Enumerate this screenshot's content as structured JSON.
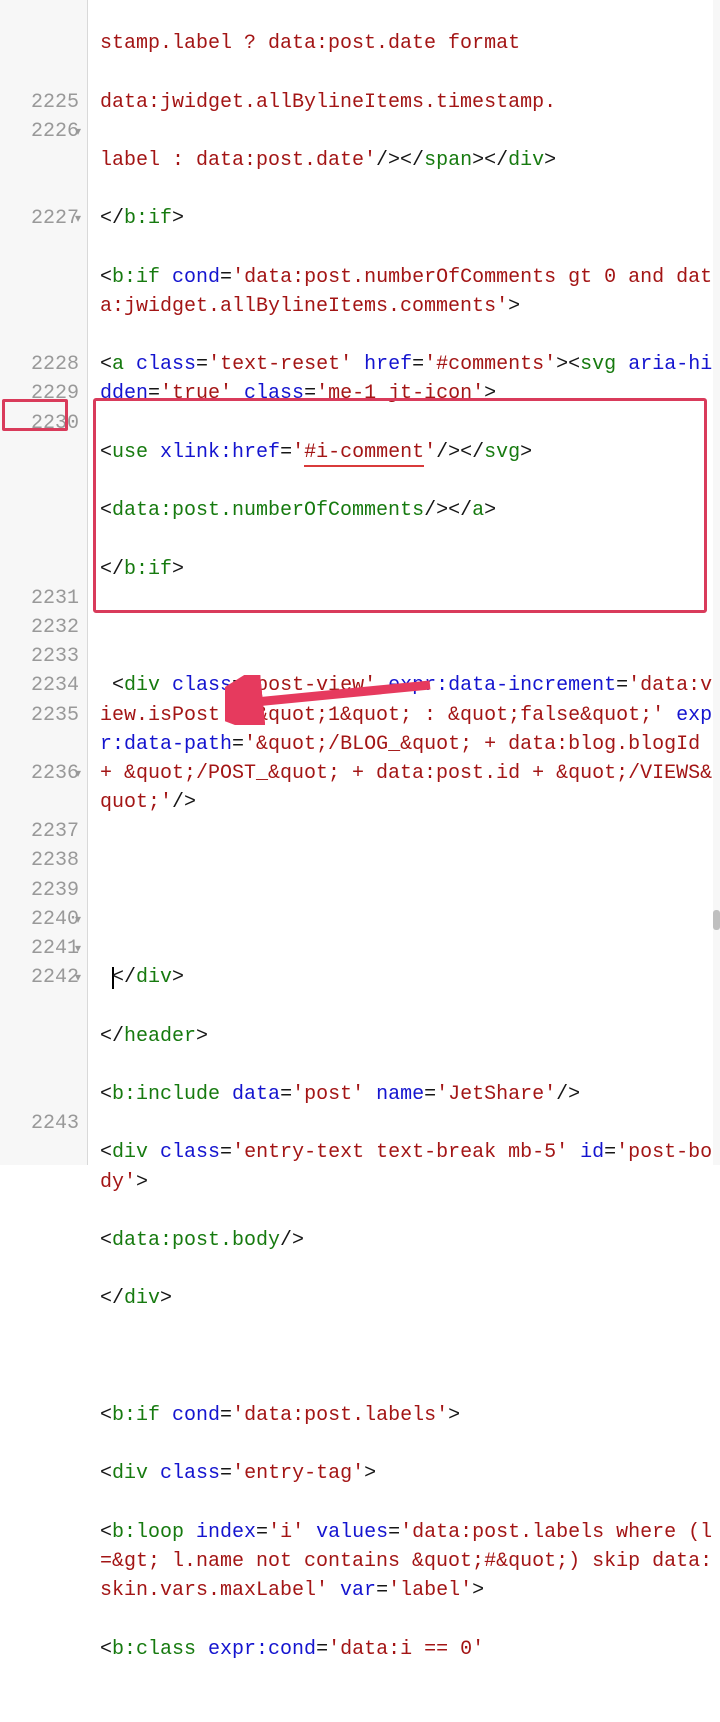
{
  "gutter": {
    "l0": "",
    "l1": "",
    "l2": "",
    "l3": "2225",
    "l4": "2226",
    "l5": "",
    "l6": "",
    "l7": "2227",
    "l8": "",
    "l9": "",
    "l10": "",
    "l11": "",
    "l12": "2228",
    "l13": "2229",
    "l14": "2230",
    "l15": "",
    "l16": "",
    "l17": "",
    "l18": "",
    "l19": "",
    "l20": "2231",
    "l21": "2232",
    "l22": "2233",
    "l23": "2234",
    "l24": "2235",
    "l25": "",
    "l26": "2236",
    "l27": "",
    "l28": "2237",
    "l29": "2238",
    "l30": "2239",
    "l31": "2240",
    "l32": "2241",
    "l33": "2242",
    "l34": "",
    "l35": "",
    "l36": "",
    "l37": "",
    "l38": "2243"
  },
  "code": {
    "c0a": "stamp.label ? data:post.date format ",
    "c1a": "data:jwidget.allBylineItems.timestamp.",
    "c2a": "label : data:post.date'",
    "c2b": "/></",
    "c2c": "span",
    "c2d": "></",
    "c2e": "div",
    "c2f": ">",
    "c3a": "</",
    "c3b": "b:if",
    "c3c": ">",
    "c4a": "<",
    "c4b": "b:if",
    "c4c": " cond",
    "c4d": "=",
    "c4e": "'data:post.numberOfComments gt 0 and data:jwidget.allBylineItems.comments'",
    "c4f": ">",
    "c7a": "<",
    "c7b": "a",
    "c7c": " class",
    "c7d": "=",
    "c7e": "'text-reset'",
    "c7f": " href",
    "c7g": "=",
    "c7h": "'#comments'",
    "c7i": "><",
    "c7j": "svg",
    "c7k": " aria-hidden",
    "c7l": "=",
    "c7m": "'true'",
    "c7n": " class",
    "c7o": "=",
    "c7p": "'me-1 jt-icon'",
    "c7q": ">",
    "c10a": "<",
    "c10b": "use",
    "c10c": " xlink:href",
    "c10d": "=",
    "c10e": "'",
    "c10f": "#i-comment",
    "c10g": "'",
    "c10h": "/></",
    "c10i": "svg",
    "c10j": ">",
    "c11a": "<",
    "c11b": "data:post.numberOfComments",
    "c11c": "/></",
    "c11d": "a",
    "c11e": ">",
    "c12a": "</",
    "c12b": "b:if",
    "c12c": ">",
    "c14a": " <",
    "c14b": "div",
    "c14c": " class",
    "c14d": "=",
    "c14e": "'post-view'",
    "c14f": " expr:data-increment",
    "c14g": "=",
    "c14h": "'data:view.isPost ? &quot;1&quot; : &quot;false&quot;'",
    "c14i": " expr:data-path",
    "c14j": "=",
    "c14k": "'&quot;/BLOG_&quot; + data:blog.blogId + &quot;/POST_&quot; + data:post.id + &quot;/VIEWS&quot;'",
    "c14l": "/>",
    "c22a": " ",
    "c22b": "</",
    "c22c": "div",
    "c22d": ">",
    "c23a": "</",
    "c23b": "header",
    "c23c": ">",
    "c24a": "<",
    "c24b": "b:include",
    "c24c": " data",
    "c24d": "=",
    "c24e": "'post'",
    "c24f": " name",
    "c24g": "=",
    "c24h": "'JetShare'",
    "c24i": "/>",
    "c26a": "<",
    "c26b": "div",
    "c26c": " class",
    "c26d": "=",
    "c26e": "'entry-text text-break mb-5'",
    "c26f": " id",
    "c26g": "=",
    "c26h": "'post-body'",
    "c26i": ">",
    "c28a": "<",
    "c28b": "data:post.body",
    "c28c": "/>",
    "c29a": "</",
    "c29b": "div",
    "c29c": ">",
    "c31a": "<",
    "c31b": "b:if",
    "c31c": " cond",
    "c31d": "=",
    "c31e": "'data:post.labels'",
    "c31f": ">",
    "c32a": "<",
    "c32b": "div",
    "c32c": " class",
    "c32d": "=",
    "c32e": "'entry-tag'",
    "c32f": ">",
    "c33a": "<",
    "c33b": "b:loop",
    "c33c": " index",
    "c33d": "=",
    "c33e": "'i'",
    "c33f": " values",
    "c33g": "=",
    "c33h": "'data:post.labels where (l =&gt; l.name not contains &quot;#&quot;) skip data:skin.vars.maxLabel'",
    "c33i": " var",
    "c33j": "=",
    "c33k": "'label'",
    "c33l": ">",
    "c38a": "<",
    "c38b": "b:class",
    "c38c": " expr:cond",
    "c38d": "=",
    "c38e": "'data:i == 0'"
  }
}
